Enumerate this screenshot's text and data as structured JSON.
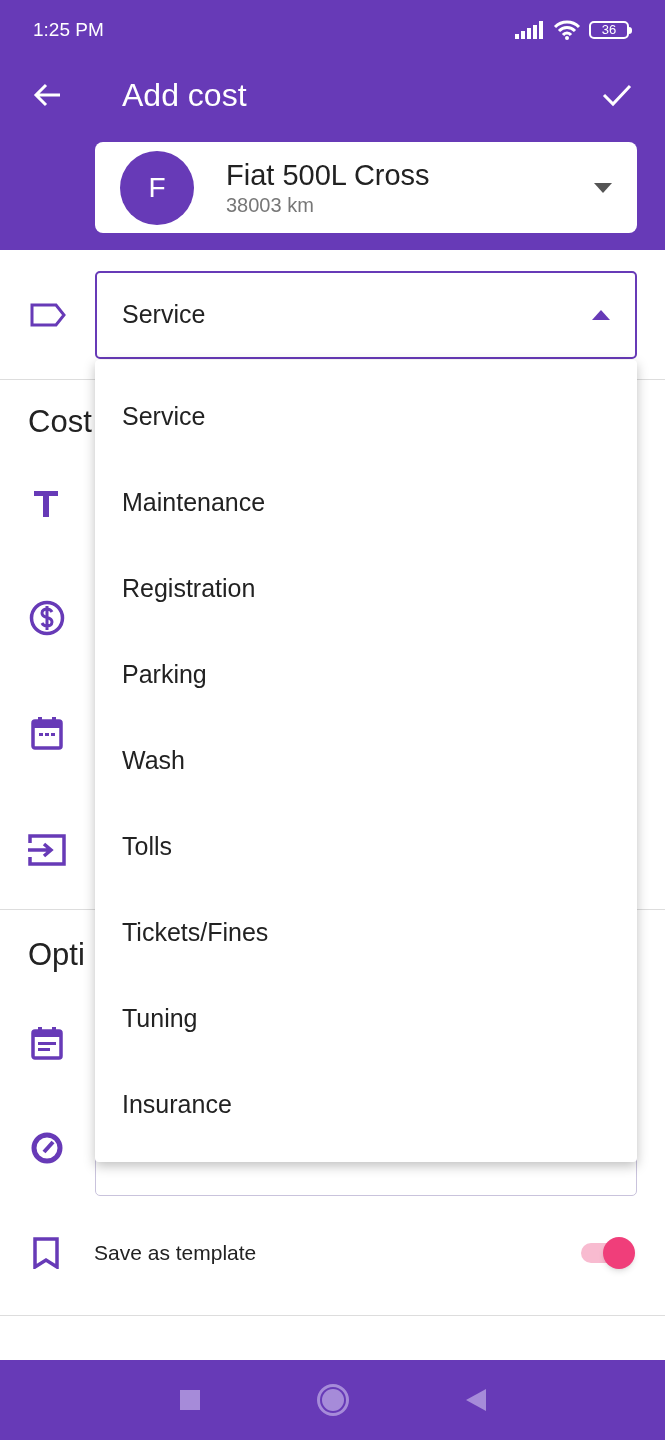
{
  "status_bar": {
    "time": "1:25 PM",
    "battery": "36"
  },
  "app_bar": {
    "title": "Add cost"
  },
  "vehicle": {
    "avatar_letter": "F",
    "name": "Fiat 500L Cross",
    "odometer": "38003 km"
  },
  "category": {
    "value": "Service",
    "expanded": true
  },
  "cost_section": {
    "title": "Cost"
  },
  "optional_section": {
    "title": "Opti",
    "save_template": {
      "label": "Save as template",
      "on": true
    }
  },
  "menu": {
    "items": [
      {
        "label": "Service"
      },
      {
        "label": "Maintenance"
      },
      {
        "label": "Registration"
      },
      {
        "label": "Parking"
      },
      {
        "label": "Wash"
      },
      {
        "label": "Tolls"
      },
      {
        "label": "Tickets/Fines"
      },
      {
        "label": "Tuning"
      },
      {
        "label": "Insurance"
      }
    ]
  }
}
